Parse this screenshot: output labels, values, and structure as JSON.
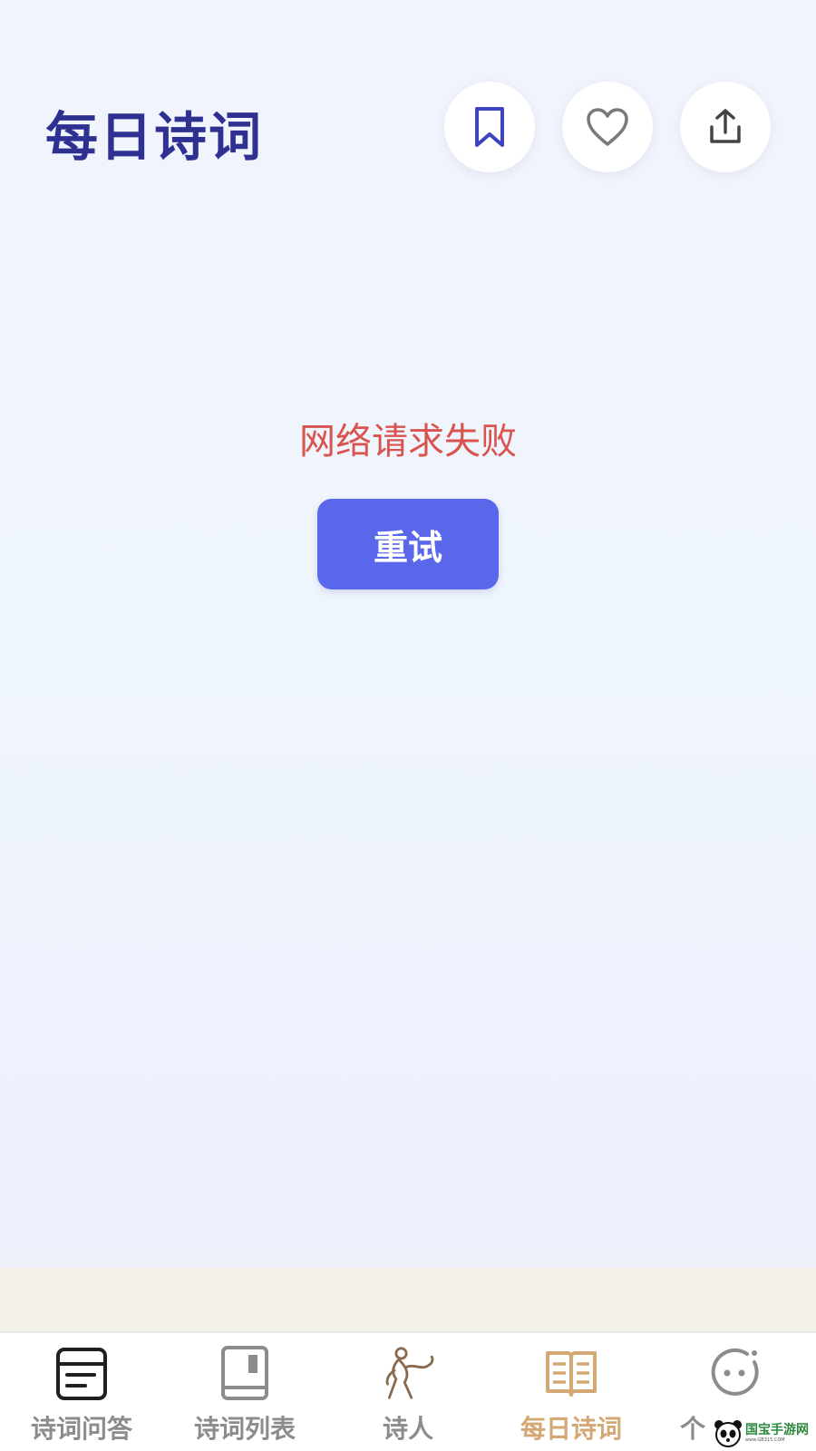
{
  "header": {
    "title": "每日诗词",
    "actions": [
      {
        "name": "bookmark",
        "icon": "bookmark-icon"
      },
      {
        "name": "favorite",
        "icon": "heart-icon"
      },
      {
        "name": "share",
        "icon": "share-icon"
      }
    ]
  },
  "error": {
    "message": "网络请求失败",
    "retry_label": "重试"
  },
  "tabbar": {
    "items": [
      {
        "label": "诗词问答",
        "icon": "qa-card-icon",
        "active": false
      },
      {
        "label": "诗词列表",
        "icon": "book-icon",
        "active": false
      },
      {
        "label": "诗人",
        "icon": "poet-figure-icon",
        "active": false
      },
      {
        "label": "每日诗词",
        "icon": "open-book-icon",
        "active": true
      },
      {
        "label": "个",
        "icon": "face-icon",
        "active": false
      }
    ]
  },
  "watermark": {
    "text": "国宝手游网",
    "url": "www.GB315.COM"
  },
  "colors": {
    "title": "#2e3192",
    "accent": "#5b67ea",
    "error": "#d9534f",
    "tab_active": "#d3a874",
    "tab_inactive": "#8c8c8c"
  }
}
